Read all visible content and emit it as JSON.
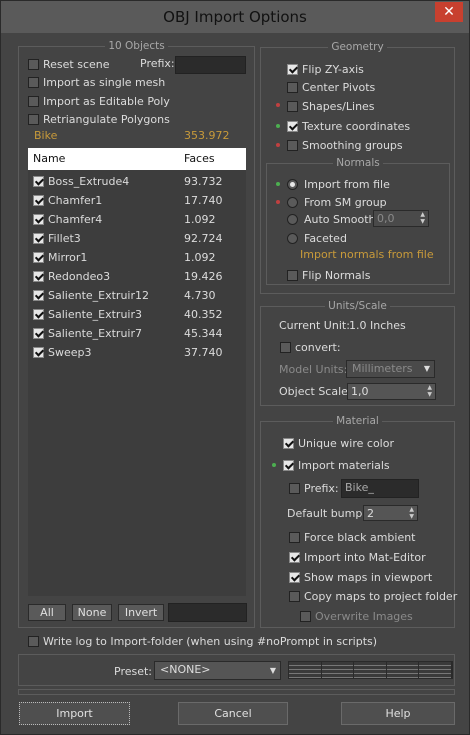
{
  "window": {
    "title": "OBJ Import Options",
    "close_glyph": "✕"
  },
  "objects": {
    "group_title": "10 Objects",
    "reset_scene": "Reset scene",
    "prefix_label": "Prefix:",
    "prefix_value": "",
    "single_mesh": "Import as single mesh",
    "editable_poly": "Import as Editable Poly",
    "retriangulate": "Retriangulate Polygons",
    "summary_name": "Bike",
    "summary_faces": "353.972",
    "col_name": "Name",
    "col_faces": "Faces",
    "rows": [
      {
        "name": "Boss_Extrude4",
        "faces": "93.732"
      },
      {
        "name": "Chamfer1",
        "faces": "17.740"
      },
      {
        "name": "Chamfer4",
        "faces": "1.092"
      },
      {
        "name": "Fillet3",
        "faces": "92.724"
      },
      {
        "name": "Mirror1",
        "faces": "1.092"
      },
      {
        "name": "Redondeo3",
        "faces": "19.426"
      },
      {
        "name": "Saliente_Extruir12",
        "faces": "4.730"
      },
      {
        "name": "Saliente_Extruir3",
        "faces": "40.352"
      },
      {
        "name": "Saliente_Extruir7",
        "faces": "45.344"
      },
      {
        "name": "Sweep3",
        "faces": "37.740"
      }
    ],
    "btn_all": "All",
    "btn_none": "None",
    "btn_invert": "Invert",
    "filter_value": ""
  },
  "geometry": {
    "group_title": "Geometry",
    "flip_zy": "Flip ZY-axis",
    "center_pivots": "Center Pivots",
    "shapes_lines": "Shapes/Lines",
    "texture_coords": "Texture coordinates",
    "smoothing_groups": "Smoothing groups"
  },
  "normals": {
    "group_title": "Normals",
    "import_from_file": "Import from file",
    "from_sm_group": "From SM group",
    "auto_smooth": "Auto Smooth:",
    "auto_smooth_value": "0,0",
    "faceted": "Faceted",
    "note": "Import normals from file",
    "flip_normals": "Flip Normals"
  },
  "units": {
    "group_title": "Units/Scale",
    "current_unit_label": "Current Unit:",
    "current_unit_value": "1.0 Inches",
    "convert": "convert:",
    "model_units_label": "Model Units:",
    "model_units_value": "Millimeters",
    "object_scale_label": "Object Scale:",
    "object_scale_value": "1,0"
  },
  "material": {
    "group_title": "Material",
    "unique_wire": "Unique wire color",
    "import_materials": "Import materials",
    "prefix_label": "Prefix:",
    "prefix_value": "Bike_",
    "default_bump_label": "Default bump:",
    "default_bump_value": "2",
    "force_black": "Force black ambient",
    "mat_editor": "Import into Mat-Editor",
    "show_maps": "Show maps in viewport",
    "copy_maps": "Copy maps to project folder",
    "overwrite": "Overwrite Images"
  },
  "footer": {
    "write_log": "Write log to Import-folder (when using #noPrompt in scripts)",
    "preset_label": "Preset:",
    "preset_value": "<NONE>",
    "import": "Import",
    "cancel": "Cancel",
    "help": "Help"
  },
  "colors": {
    "accent_orange": "#c89a3a",
    "close_red": "#c8402f",
    "dot_green": "#4caf50",
    "dot_red": "#c04040"
  }
}
